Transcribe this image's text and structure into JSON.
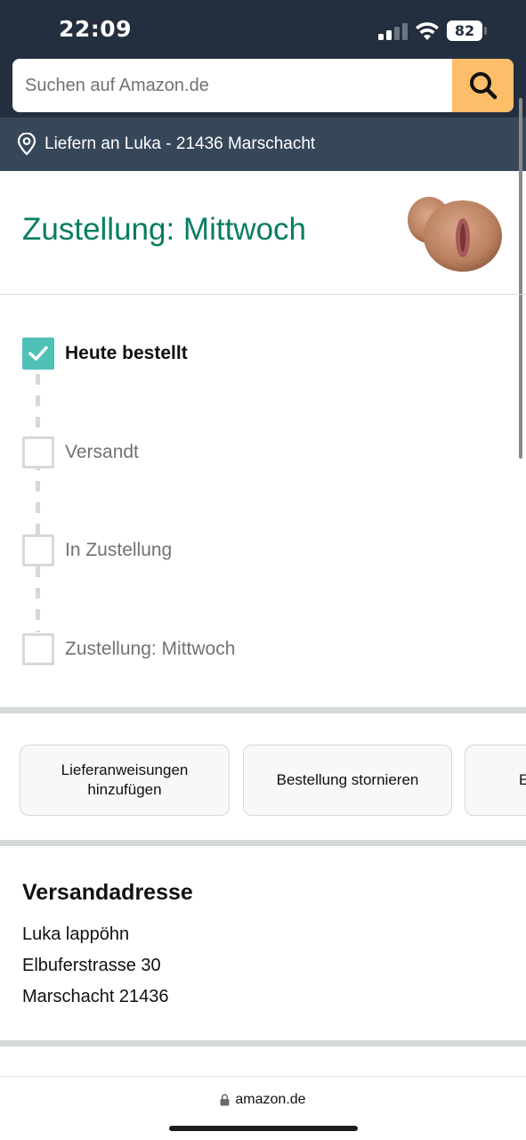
{
  "status_bar": {
    "time": "22:09",
    "battery": "82"
  },
  "search": {
    "placeholder": "Suchen auf Amazon.de"
  },
  "deliver_to": {
    "text": "Liefern an Luka - 21436 Marschacht"
  },
  "delivery": {
    "title": "Zustellung: Mittwoch"
  },
  "tracking_steps": [
    {
      "label": "Heute bestellt",
      "done": true
    },
    {
      "label": "Versandt",
      "done": false
    },
    {
      "label": "In Zustellung",
      "done": false
    },
    {
      "label": "Zustellung: Mittwoch",
      "done": false
    }
  ],
  "actions": {
    "add_instructions_line1": "Lieferanweisungen",
    "add_instructions_line2": "hinzufügen",
    "cancel_order": "Bestellung stornieren",
    "third_partial": "E"
  },
  "shipping_address": {
    "heading": "Versandadresse",
    "name": "Luka lappöhn",
    "street": "Elbuferstrasse 30",
    "city": "Marschacht 21436"
  },
  "browser": {
    "url": "amazon.de"
  },
  "colors": {
    "accent_teal": "#067d62",
    "check_teal": "#4fc1b7",
    "search_button": "#febd69",
    "header": "#232f3e"
  }
}
